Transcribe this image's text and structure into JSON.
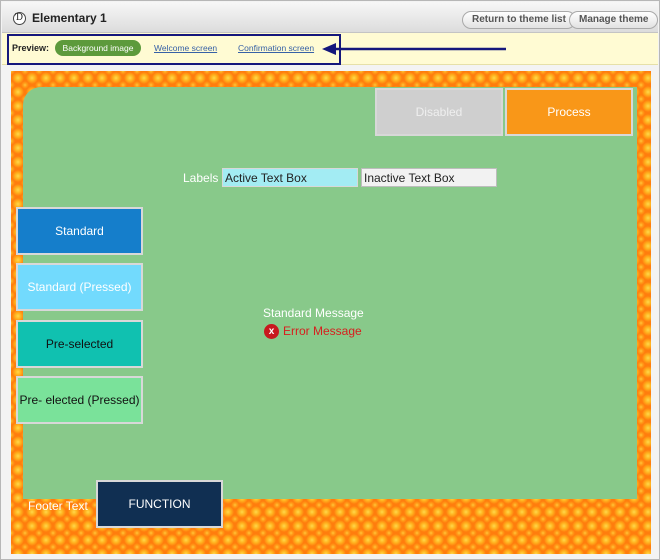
{
  "header": {
    "logo_icon": "theme-logo-icon",
    "logo_glyph": "Ɗ",
    "title": "Elementary 1",
    "return_label": "Return to theme list",
    "manage_label": "Manage theme"
  },
  "preview": {
    "label": "Preview:",
    "active_option": "Background image",
    "links": [
      "Welcome screen",
      "Confirmation screen"
    ],
    "annotation_color": "#15177c"
  },
  "theme": {
    "disabled_label": "Disabled",
    "process_label": "Process",
    "labels_text": "Labels",
    "active_textbox": "Active Text Box",
    "inactive_textbox": "Inactive Text Box",
    "standard_label": "Standard",
    "standard_pressed_label": "Standard (Pressed)",
    "preselected_label": "Pre-selected",
    "preselected_pressed_label": "Pre- elected (Pressed)",
    "standard_message": "Standard Message",
    "error_message": "Error Message",
    "error_icon_glyph": "x",
    "footer_text": "Footer Text",
    "function_label": "FUNCTION"
  },
  "colors": {
    "background_orange": "#ff7d0d",
    "panel_green": "#88c98a",
    "process_orange": "#f99718",
    "standard_blue": "#157ecb",
    "standard_pressed": "#72dafd",
    "preselected": "#10c1b0",
    "preselected_pressed": "#7ae29a",
    "function_navy": "#102f52",
    "error_red": "#d71e1e"
  }
}
